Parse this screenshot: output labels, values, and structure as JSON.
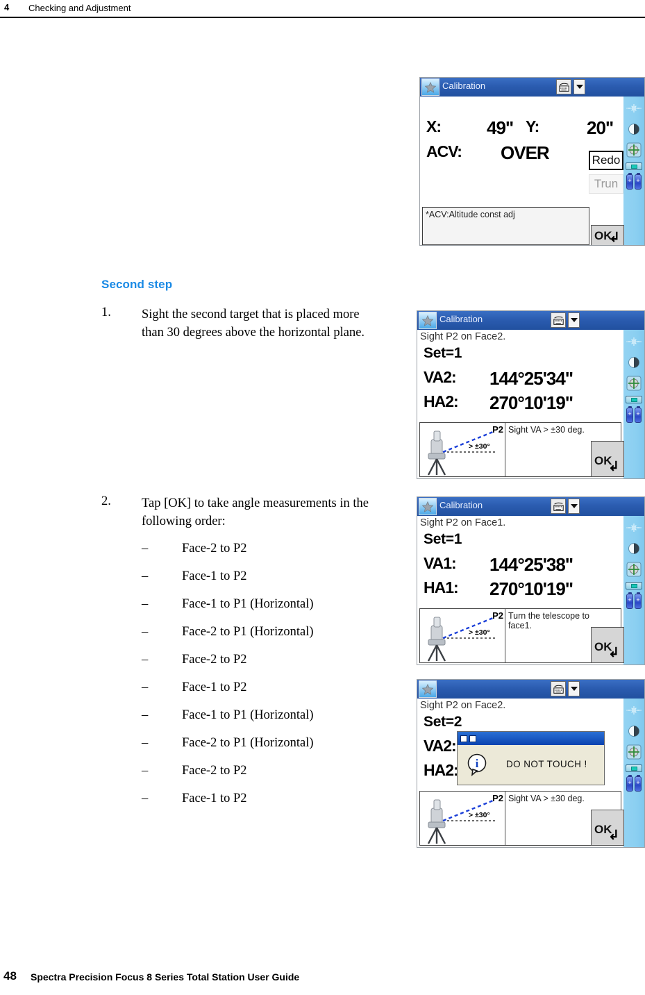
{
  "running_head": {
    "chapter_number": "4",
    "chapter_title": "Checking and Adjustment"
  },
  "footer": {
    "page_number": "48",
    "guide_title": "Spectra Precision Focus 8 Series Total Station User Guide"
  },
  "section": {
    "heading": "Second step"
  },
  "steps": [
    {
      "number": "1.",
      "text": "Sight the second target that is placed more than 30 degrees above the horizontal plane."
    },
    {
      "number": "2.",
      "text": "Tap [OK] to take angle measurements in the following order:"
    }
  ],
  "sublist": {
    "dash": "–",
    "items": [
      "Face-2 to P2",
      "Face-1 to P2",
      "Face-1 to P1 (Horizontal)",
      "Face-2 to P1 (Horizontal)",
      "Face-2 to P2",
      "Face-1 to P2",
      "Face-1 to P1 (Horizontal)",
      "Face-2 to P1 (Horizontal)",
      "Face-2 to P2",
      "Face-1 to P2"
    ]
  },
  "colors": {
    "heading_blue": "#1a8ae5",
    "titlebar_blue": "#2b5cb0",
    "rail_blue": "#8bcff1",
    "dialog_beige": "#ece9d8"
  },
  "screens": [
    {
      "id": "calibration-result",
      "title": "Calibration",
      "rows": [
        {
          "label": "X:",
          "value": "49\""
        },
        {
          "label": "Y:",
          "value": "20\""
        },
        {
          "label": "ACV:",
          "value": "OVER"
        }
      ],
      "buttons": {
        "redo": "Redo",
        "trun": "Trun",
        "ok": "OK"
      },
      "note": "*ACV:Altitude const adj",
      "rail_icons": [
        "laser-icon",
        "contrast-icon",
        "crosshair-icon",
        "bubble-level-icon",
        "battery-icon"
      ]
    },
    {
      "id": "sight-p2-face2-set1",
      "title": "Calibration",
      "prompt": "Sight P2 on Face2.",
      "set_label": "Set=1",
      "rows": [
        {
          "label": "VA2:",
          "value": "144°25'34\""
        },
        {
          "label": "HA2:",
          "value": "270°10'19\""
        }
      ],
      "diagram": {
        "point_label": "P2",
        "angle_label": "> ±30°"
      },
      "hint": "Sight VA > ±30 deg.",
      "buttons": {
        "ok": "OK"
      }
    },
    {
      "id": "sight-p2-face1-set1",
      "title": "Calibration",
      "prompt": "Sight P2 on Face1.",
      "set_label": "Set=1",
      "rows": [
        {
          "label": "VA1:",
          "value": "144°25'38\""
        },
        {
          "label": "HA1:",
          "value": "270°10'19\""
        }
      ],
      "diagram": {
        "point_label": "P2",
        "angle_label": "> ±30°"
      },
      "hint": "Turn the telescope to face1.",
      "buttons": {
        "ok": "OK"
      }
    },
    {
      "id": "sight-p2-face2-set2",
      "title": "",
      "prompt": "Sight P2 on Face2.",
      "set_label": "Set=2",
      "rows": [
        {
          "label": "VA2:",
          "value": ""
        },
        {
          "label": "HA2:",
          "value": ""
        }
      ],
      "dialog": {
        "message": "DO NOT TOUCH !"
      },
      "diagram": {
        "point_label": "P2",
        "angle_label": "> ±30°"
      },
      "hint": "Sight VA > ±30 deg.",
      "buttons": {
        "ok": "OK"
      }
    }
  ]
}
